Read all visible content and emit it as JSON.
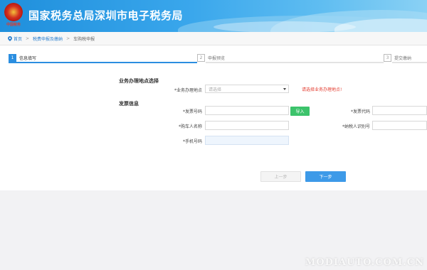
{
  "header": {
    "title": "国家税务总局深圳市电子税务局",
    "emblem_caption": "中国税务",
    "colors": {
      "bar_start": "#1f8fdc",
      "bar_end": "#8ad1f4"
    }
  },
  "breadcrumb": {
    "icon": "location-pin-icon",
    "home": "首页",
    "section": "税费申报及缴纳",
    "current": "车购税申报"
  },
  "steps": [
    {
      "num": "1",
      "label": "信息填写",
      "active": true
    },
    {
      "num": "2",
      "label": "申报预览",
      "active": false
    },
    {
      "num": "3",
      "label": "提交缴纳",
      "active": false
    }
  ],
  "location_section": {
    "title": "业务办理地点选择",
    "label": "*业务办理地点",
    "select_placeholder": "请选择",
    "warning": "请选择业务办理地点!"
  },
  "invoice_section": {
    "title": "发票信息",
    "fields": {
      "invoice_number": {
        "label": "*发票号码",
        "value": ""
      },
      "invoice_code": {
        "label": "*发票代码",
        "value": ""
      },
      "buyer_name": {
        "label": "*购车人名称",
        "value": ""
      },
      "taxpayer_id": {
        "label": "*纳税人识别号",
        "value": ""
      },
      "phone": {
        "label": "*手机号码",
        "value": ""
      }
    },
    "import_button": "导入"
  },
  "actions": {
    "prev": "上一步",
    "next": "下一步"
  },
  "watermark": "MODIAUTO.COM.CN",
  "colors": {
    "accent": "#2b8ee0",
    "import_green": "#3cc36b",
    "warning_red": "#e33b2e"
  }
}
